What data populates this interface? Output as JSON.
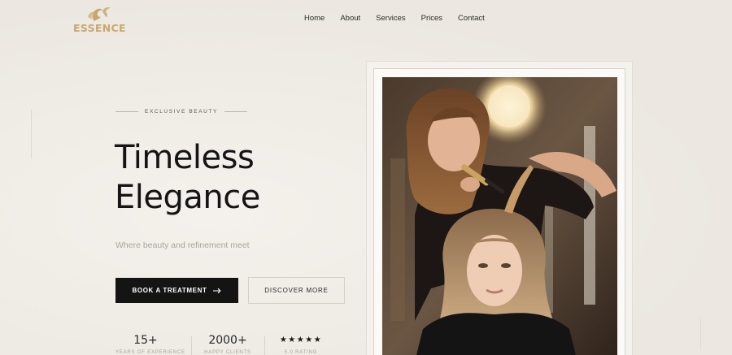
{
  "brand": {
    "name": "ESSENCE",
    "accent_color": "#c8a86e",
    "logo_icon": "woman-silhouette-icon"
  },
  "nav": {
    "items": [
      {
        "label": "Home"
      },
      {
        "label": "About"
      },
      {
        "label": "Services"
      },
      {
        "label": "Prices"
      },
      {
        "label": "Contact"
      }
    ]
  },
  "hero": {
    "eyebrow": "EXCLUSIVE BEAUTY",
    "headline_line1": "Timeless",
    "headline_line2": "Elegance",
    "subtitle": "Where beauty and refinement meet",
    "primary_button": "BOOK A TREATMENT",
    "primary_button_icon": "arrow-right-icon",
    "secondary_button": "DISCOVER MORE"
  },
  "stats": [
    {
      "value": "15+",
      "label": "YEARS OF EXPERIENCE"
    },
    {
      "value": "2000+",
      "label": "HAPPY CLIENTS"
    },
    {
      "value": "★★★★★",
      "label": "5.0 RATING"
    }
  ],
  "image": {
    "subject": "stylist curling client hair in salon"
  },
  "colors": {
    "background": "#f1eee9",
    "primary_button_bg": "#141414",
    "text_dark": "#141414",
    "text_muted": "#a9a49c"
  }
}
